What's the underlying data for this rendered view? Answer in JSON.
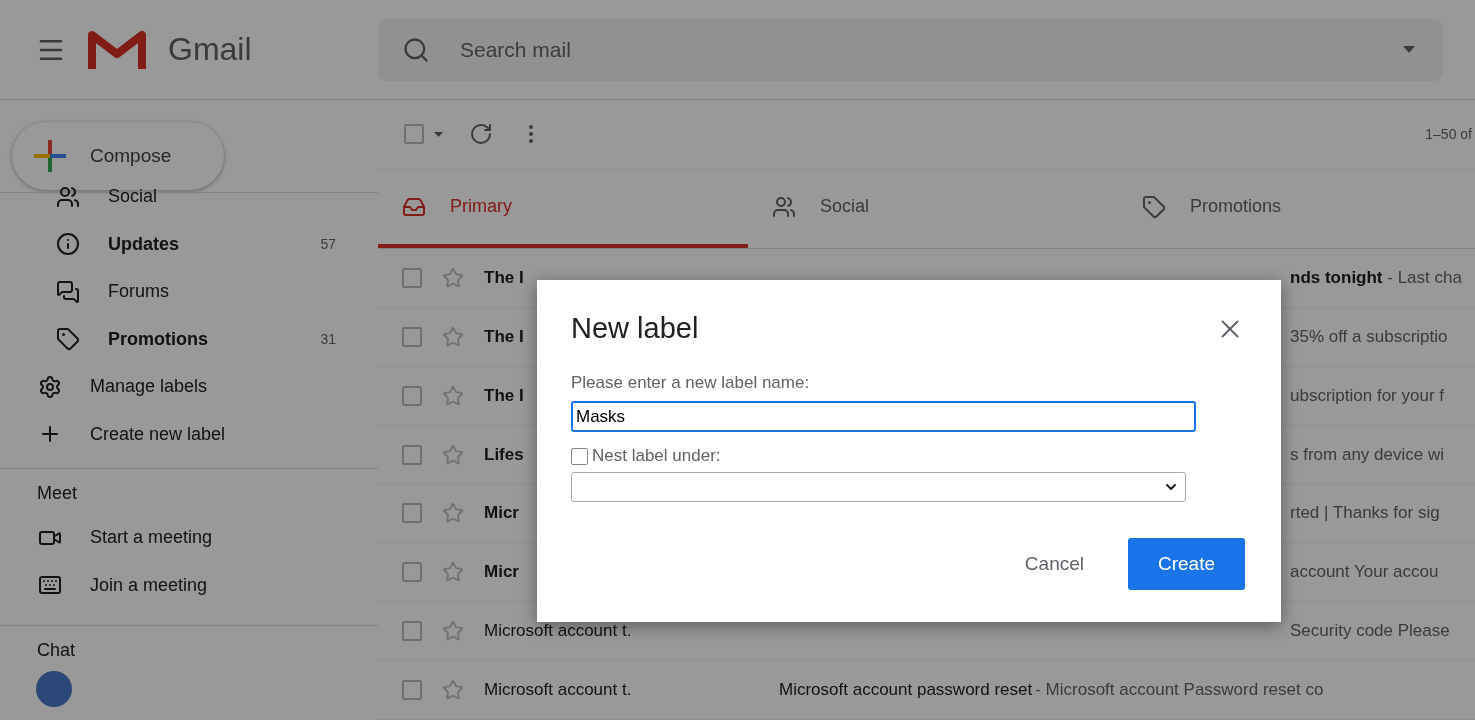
{
  "header": {
    "app_name": "Gmail",
    "search": {
      "placeholder": "Search mail"
    }
  },
  "compose": {
    "label": "Compose"
  },
  "sidebar": {
    "items": [
      {
        "label": "Social",
        "unread": false
      },
      {
        "label": "Updates",
        "count": "57",
        "unread": true
      },
      {
        "label": "Forums",
        "unread": false
      },
      {
        "label": "Promotions",
        "count": "31",
        "unread": true
      },
      {
        "label": "Manage labels",
        "unread": false
      },
      {
        "label": "Create new label",
        "unread": false
      }
    ],
    "meet": {
      "title": "Meet",
      "items": [
        {
          "label": "Start a meeting"
        },
        {
          "label": "Join a meeting"
        }
      ]
    },
    "chat": {
      "title": "Chat"
    }
  },
  "toolbar": {
    "select_all": {
      "checked": false
    },
    "pagination": "1–50 of"
  },
  "tabs": [
    {
      "label": "Primary",
      "selected": true
    },
    {
      "label": "Social",
      "selected": false
    },
    {
      "label": "Promotions",
      "selected": false
    }
  ],
  "rows": [
    {
      "checked": false,
      "sender": "The I",
      "unread": true,
      "kind": "covered",
      "subject": "nds tonight",
      "snippet": " - Last cha"
    },
    {
      "checked": false,
      "sender": "The I",
      "unread": true,
      "kind": "covered",
      "snippet": "35% off a subscriptio"
    },
    {
      "checked": false,
      "sender": "The I",
      "unread": true,
      "kind": "covered",
      "snippet": "ubscription for your f"
    },
    {
      "checked": false,
      "sender": "Lifes",
      "unread": true,
      "kind": "covered",
      "snippet": "s from any device wi"
    },
    {
      "checked": false,
      "sender": "Micr",
      "unread": true,
      "kind": "covered",
      "snippet": "rted | Thanks for sig"
    },
    {
      "checked": false,
      "sender": "Micr",
      "unread": true,
      "kind": "covered",
      "snippet": "account Your accou"
    },
    {
      "checked": false,
      "sender": "Microsoft account t.",
      "unread": false,
      "kind": "covered",
      "snippet": "Security code Please"
    },
    {
      "checked": false,
      "sender": "Microsoft account t.",
      "unread": false,
      "kind": "full",
      "subject": "Microsoft account password reset",
      "snippet": " - Microsoft account Password reset co"
    }
  ],
  "dialog": {
    "title": "New label",
    "prompt": "Please enter a new label name:",
    "value": "Masks",
    "nest": {
      "label": "Nest label under:",
      "checked": false
    },
    "cancel": "Cancel",
    "create": "Create"
  }
}
